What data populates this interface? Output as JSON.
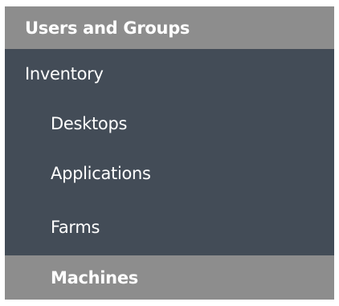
{
  "nav": {
    "top_item": "Users and Groups",
    "section": "Inventory",
    "items": [
      {
        "label": "Desktops"
      },
      {
        "label": "Applications"
      },
      {
        "label": "Farms"
      },
      {
        "label": "Machines",
        "selected": true
      }
    ]
  },
  "colors": {
    "dark_panel": "#434c57",
    "highlight": "#8d8d8d",
    "text": "#ffffff"
  }
}
